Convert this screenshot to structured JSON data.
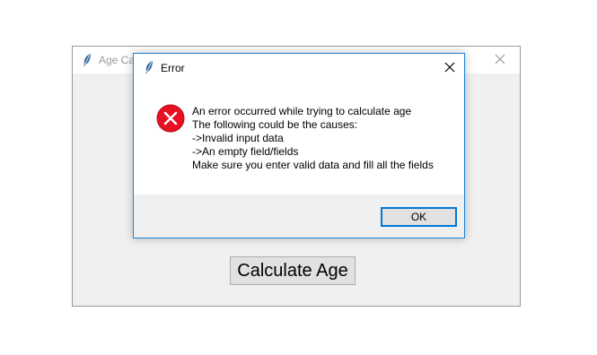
{
  "main_window": {
    "title": "Age Calculator",
    "calculate_button_label": "Calculate Age"
  },
  "dialog": {
    "title": "Error",
    "message_lines": [
      "An error occurred while trying to calculate age",
      "The following could be the causes:",
      "->Invalid input data",
      "->An empty field/fields",
      "Make sure you enter valid data and fill all the fields"
    ],
    "ok_label": "OK"
  },
  "colors": {
    "dialog_border": "#1883d7",
    "error_icon": "#e81123",
    "ok_focus_border": "#0078d7"
  },
  "icons": {
    "app_icon": "feather-icon",
    "close": "close-icon",
    "error": "error-icon"
  }
}
